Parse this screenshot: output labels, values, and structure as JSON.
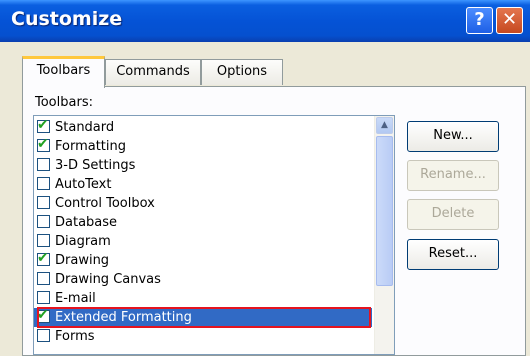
{
  "window": {
    "title": "Customize",
    "help_glyph": "?",
    "close_glyph": "✕"
  },
  "tabs": [
    {
      "label": "Toolbars",
      "active": true
    },
    {
      "label": "Commands",
      "active": false
    },
    {
      "label": "Options",
      "active": false
    }
  ],
  "panel": {
    "list_label": "Toolbars:",
    "items": [
      {
        "label": "Standard",
        "checked": true,
        "selected": false
      },
      {
        "label": "Formatting",
        "checked": true,
        "selected": false
      },
      {
        "label": "3-D Settings",
        "checked": false,
        "selected": false
      },
      {
        "label": "AutoText",
        "checked": false,
        "selected": false
      },
      {
        "label": "Control Toolbox",
        "checked": false,
        "selected": false
      },
      {
        "label": "Database",
        "checked": false,
        "selected": false
      },
      {
        "label": "Diagram",
        "checked": false,
        "selected": false
      },
      {
        "label": "Drawing",
        "checked": true,
        "selected": false
      },
      {
        "label": "Drawing Canvas",
        "checked": false,
        "selected": false
      },
      {
        "label": "E-mail",
        "checked": false,
        "selected": false
      },
      {
        "label": "Extended Formatting",
        "checked": true,
        "selected": true
      },
      {
        "label": "Forms",
        "checked": false,
        "selected": false
      }
    ],
    "scroll_up_glyph": "▲"
  },
  "buttons": {
    "new": "New...",
    "rename": "Rename...",
    "delete": "Delete",
    "reset": "Reset..."
  },
  "colors": {
    "titlebar": "#0553d6",
    "selection": "#316ac5",
    "highlight_outline": "#e5141f",
    "check": "#21a121"
  }
}
